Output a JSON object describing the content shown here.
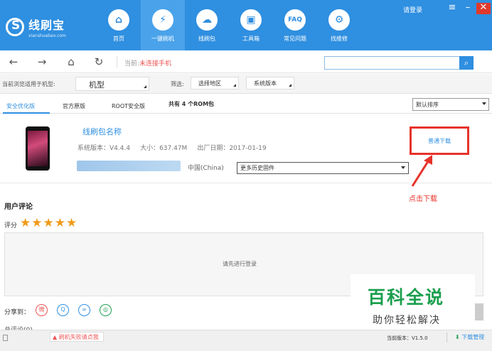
{
  "app": {
    "name": "线刷宝",
    "domain": "xianshuabao.com",
    "login": "请登录"
  },
  "nav": [
    {
      "label": "首页",
      "icon": "home-icon",
      "glyph": "⌂"
    },
    {
      "label": "一键刷机",
      "icon": "flash-icon",
      "glyph": "⚡"
    },
    {
      "label": "线刷包",
      "icon": "download-cloud-icon",
      "glyph": "☁"
    },
    {
      "label": "工具箱",
      "icon": "toolbox-icon",
      "glyph": "▣"
    },
    {
      "label": "常见问题",
      "icon": "faq-icon",
      "glyph": "FAQ"
    },
    {
      "label": "找维修",
      "icon": "repair-icon",
      "glyph": "⚙"
    }
  ],
  "address": {
    "current_prefix": "当前:",
    "current_value": "未连接手机",
    "search_value": ""
  },
  "filter": {
    "model_label": "当前浏览适用于机型:",
    "model_value": "机型",
    "filter_label": "筛选:",
    "region_select": "选择地区",
    "version_select": "系统版本"
  },
  "tabs": [
    {
      "label": "安全优化版",
      "active": true
    },
    {
      "label": "官方原版",
      "active": false
    },
    {
      "label": "ROOT安全版",
      "active": false
    }
  ],
  "rom_count": "共有 4 个ROM包",
  "sort": "默认排序",
  "rom": {
    "name": "线刷包名称",
    "version": "系统版本：V4.4.4",
    "size": "大小：637.47M",
    "date": "出厂日期：2017-01-19",
    "region": "中国(China)",
    "history": "更多历史固件",
    "download": "普通下载"
  },
  "annotation": "点击下载",
  "comments": {
    "title": "用户评论",
    "rating_label": "评分",
    "stars": "★★★★★",
    "hint": "请先进行登录",
    "share_label": "分享到：",
    "total_label": "总评论(0)"
  },
  "watermark": {
    "title": "百科全说",
    "subtitle": "助你轻松解决"
  },
  "status": {
    "warning": "刷机失败请点我",
    "version": "当前版本：V1.5.0",
    "download_manager": "下载管理"
  },
  "colors": {
    "brand_blue": "#2f8fe0",
    "alert_red": "#e6332a",
    "star_orange": "#f19a1a",
    "watermark_green": "#1b9f4e"
  }
}
